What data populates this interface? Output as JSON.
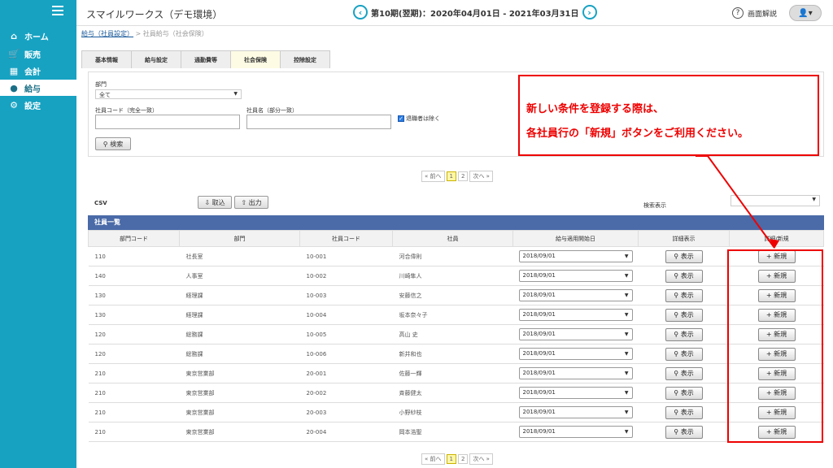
{
  "sidebar": {
    "items": [
      {
        "label": "ホーム",
        "icon": "home-icon"
      },
      {
        "label": "販売",
        "icon": "cart-icon"
      },
      {
        "label": "会計",
        "icon": "calculator-icon"
      },
      {
        "label": "給与",
        "icon": "money-bag-icon"
      },
      {
        "label": "設定",
        "icon": "gear-icon"
      }
    ]
  },
  "header": {
    "title": "スマイルワークス（デモ環境）",
    "period": "第10期(翌期)：2020年04月01日 - 2021年03月31日",
    "help": "画面解説"
  },
  "breadcrumb": {
    "link": "給与（社員設定）",
    "current": "社員給与（社会保険）"
  },
  "tabs": [
    "基本情報",
    "給与設定",
    "通勤費等",
    "社会保険",
    "控除設定"
  ],
  "search": {
    "dept_label": "部門",
    "dept_value": "全て",
    "code_label": "社員コード（完全一致）",
    "name_label": "社員名（部分一致）",
    "exclude_retired": "退職者は除く",
    "search_button": "検索"
  },
  "pager": {
    "prev": "« 前へ",
    "pages": [
      "1",
      "2"
    ],
    "next": "次へ »"
  },
  "csv": {
    "label": "CSV",
    "import": "取込",
    "export": "出力",
    "display_label": "検索表示"
  },
  "table": {
    "title": "社員一覧",
    "columns": [
      "部門コード",
      "部門",
      "社員コード",
      "社員",
      "給与適用開始日",
      "詳細表示",
      "詳細/新規"
    ],
    "view_button": "表示",
    "new_button": "新規",
    "rows": [
      {
        "dept_code": "110",
        "dept": "社長室",
        "emp_code": "10-001",
        "emp": "河合偉則",
        "date": "2018/09/01"
      },
      {
        "dept_code": "140",
        "dept": "人事室",
        "emp_code": "10-002",
        "emp": "川崎隼人",
        "date": "2018/09/01"
      },
      {
        "dept_code": "130",
        "dept": "経理課",
        "emp_code": "10-003",
        "emp": "安藤信之",
        "date": "2018/09/01"
      },
      {
        "dept_code": "130",
        "dept": "経理課",
        "emp_code": "10-004",
        "emp": "坂本奈々子",
        "date": "2018/09/01"
      },
      {
        "dept_code": "120",
        "dept": "総務課",
        "emp_code": "10-005",
        "emp": "高山 史",
        "date": "2018/09/01"
      },
      {
        "dept_code": "120",
        "dept": "総務課",
        "emp_code": "10-006",
        "emp": "新井和也",
        "date": "2018/09/01"
      },
      {
        "dept_code": "210",
        "dept": "東京営業部",
        "emp_code": "20-001",
        "emp": "佐藤一輝",
        "date": "2018/09/01"
      },
      {
        "dept_code": "210",
        "dept": "東京営業部",
        "emp_code": "20-002",
        "emp": "斉藤健太",
        "date": "2018/09/01"
      },
      {
        "dept_code": "210",
        "dept": "東京営業部",
        "emp_code": "20-003",
        "emp": "小野紗枝",
        "date": "2018/09/01"
      },
      {
        "dept_code": "210",
        "dept": "東京営業部",
        "emp_code": "20-004",
        "emp": "岡本浩聖",
        "date": "2018/09/01"
      }
    ]
  },
  "callout": {
    "line1": "新しい条件を登録する際は、",
    "line2": "各社員行の「新規」ボタンをご利用ください。"
  },
  "colors": {
    "sidebar": "#17a2c2",
    "table_header": "#4a6aa8",
    "callout": "#e00000"
  }
}
